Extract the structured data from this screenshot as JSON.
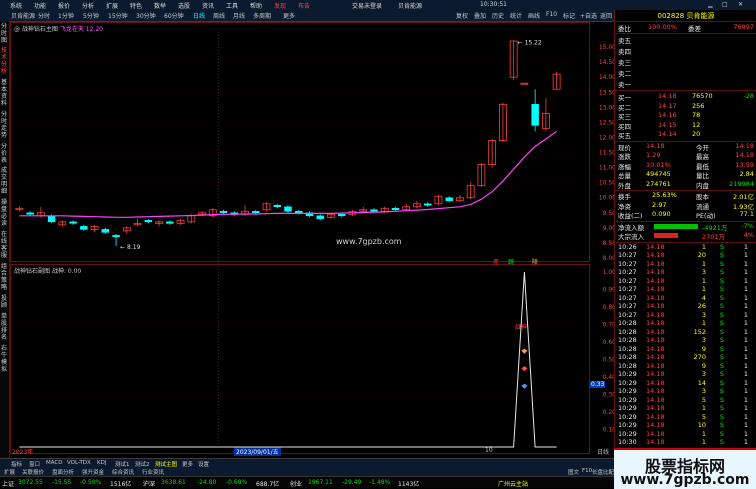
{
  "menubar": {
    "items": [
      "系统",
      "功能",
      "报价",
      "分析",
      "扩展",
      "特色",
      "数举",
      "选股",
      "资讯",
      "工具",
      "帮助"
    ],
    "highlight": [
      "发现",
      "布告"
    ],
    "center": [
      "交易未登录",
      "贝肯能源"
    ],
    "time": "10:30:51"
  },
  "toolbar": {
    "items": [
      "贝肯能源",
      "分时",
      "1分钟",
      "5分钟",
      "15分钟",
      "30分钟",
      "60分钟",
      "日线",
      "周线",
      "月线",
      "多周期",
      "更多"
    ],
    "active": "日线",
    "right": [
      "复权",
      "叠加",
      "历史",
      "统计",
      "画线",
      "F10",
      "标记",
      "+自选",
      "返回"
    ]
  },
  "leftrail": [
    "分时图",
    "技术分析",
    "基本资料",
    "分时走势",
    "分价表",
    "成交明细",
    "操盘必读",
    "在线客服",
    "组合策略",
    "投顾",
    "单股排名",
    "右牛模拟"
  ],
  "mainchart": {
    "title": "战神钻石主图",
    "title_prefix": "@",
    "pink_label": "飞龙在天",
    "pink_value": "12.20",
    "high_label": "15.22",
    "low_label": "8.19",
    "ticks": [
      "15.00",
      "14.50",
      "14.00",
      "13.50",
      "13.00",
      "12.50",
      "12.00",
      "11.50",
      "11.00",
      "10.50",
      "10.00",
      "9.50",
      "9.00",
      "8.50",
      "8.00"
    ]
  },
  "subchart": {
    "title": "战神钻石副图",
    "title2": "战神: 0.00",
    "signals": [
      "赤",
      "跳",
      "陵"
    ],
    "peak_label": "战神",
    "value_badge": "0.33",
    "ticks": [
      "1.00",
      "0.90",
      "0.80",
      "0.70",
      "0.60",
      "0.50",
      "0.40",
      "0.30",
      "0.20",
      "0.10"
    ],
    "date_label": "2023/09/01/五",
    "year_label": "2023年",
    "x_tick": "10",
    "right_tag": "日线"
  },
  "bottomtabs": [
    "指标",
    "窗口",
    "MACD",
    "VOL-TDX",
    "KDJ",
    "测试1",
    "测试2",
    "测试主图",
    "更多",
    "设置"
  ],
  "bottomtabs_selected": "测试主图",
  "bottom2": [
    "扩展",
    "关联报价",
    "盘面分析",
    "强升资金",
    "综合资讯",
    "行业资讯"
  ],
  "bottom2_right": [
    "图文",
    "F10",
    "长盘比配"
  ],
  "indexbar": [
    {
      "name": "上证",
      "value": "3072.55",
      "chg": "-15.55",
      "pct": "-0.50%",
      "amt": "1516亿"
    },
    {
      "name": "沪深",
      "value": "3638.61",
      "chg": "-24.80",
      "pct": "-0.68%",
      "amt": "688.7亿"
    },
    {
      "name": "创业",
      "value": "1967.11",
      "chg": "-29.49",
      "pct": "-1.48%",
      "amt": "1143亿"
    }
  ],
  "indexbar_right": "广州云主站",
  "quote": {
    "code": "002828",
    "name": "贝肯能源",
    "webi_label": "委比",
    "webi": "100.00%",
    "weicha_label": "委差",
    "weicha": "76997",
    "sell": [
      {
        "label": "卖五",
        "price": "",
        "vol": ""
      },
      {
        "label": "卖四",
        "price": "",
        "vol": ""
      },
      {
        "label": "卖三",
        "price": "",
        "vol": ""
      },
      {
        "label": "卖二",
        "price": "",
        "vol": ""
      },
      {
        "label": "卖一",
        "price": "",
        "vol": ""
      }
    ],
    "buy": [
      {
        "label": "买一",
        "price": "14.18",
        "vol": "76570",
        "chg": "-28"
      },
      {
        "label": "买二",
        "price": "14.17",
        "vol": "256",
        "chg": ""
      },
      {
        "label": "买三",
        "price": "14.16",
        "vol": "78",
        "chg": ""
      },
      {
        "label": "买四",
        "price": "14.15",
        "vol": "12",
        "chg": ""
      },
      {
        "label": "买五",
        "price": "14.14",
        "vol": "20",
        "chg": ""
      }
    ],
    "stats": [
      {
        "l1": "现价",
        "v1": "14.18",
        "l2": "今开",
        "v2": "14.18"
      },
      {
        "l1": "涨跌",
        "v1": "1.29",
        "l2": "最高",
        "v2": "14.18"
      },
      {
        "l1": "涨幅",
        "v1": "10.01%",
        "l2": "最低",
        "v2": "13.59"
      },
      {
        "l1": "总量",
        "v1": "494745",
        "l2": "量比",
        "v2": "2.84"
      },
      {
        "l1": "外盘",
        "v1": "274761",
        "l2": "内盘",
        "v2": "219984"
      }
    ],
    "stats2": [
      {
        "l1": "换手",
        "v1": "25.63%",
        "l2": "股本",
        "v2": "2.01亿"
      },
      {
        "l1": "净资",
        "v1": "2.97",
        "l2": "流通",
        "v2": "1.93亿"
      },
      {
        "l1": "收益(二)",
        "v1": "0.090",
        "l2": "PE(动)",
        "v2": "77.1"
      }
    ],
    "flows": [
      {
        "label": "净流入额",
        "value": "-4921万",
        "pct": "-7%"
      },
      {
        "label": "大宗流入",
        "value": "2701万",
        "pct": "4%"
      }
    ],
    "ticks": [
      {
        "t": "10:26",
        "p": "14.18",
        "v": "1",
        "s": "S",
        "n": "1"
      },
      {
        "t": "10:27",
        "p": "14.18",
        "v": "20",
        "s": "S",
        "n": "1"
      },
      {
        "t": "10:27",
        "p": "14.18",
        "v": "1",
        "s": "S",
        "n": "1"
      },
      {
        "t": "10:27",
        "p": "14.18",
        "v": "3",
        "s": "S",
        "n": "1"
      },
      {
        "t": "10:27",
        "p": "14.18",
        "v": "1",
        "s": "S",
        "n": "1"
      },
      {
        "t": "10:27",
        "p": "14.18",
        "v": "1",
        "s": "S",
        "n": "1"
      },
      {
        "t": "10:27",
        "p": "14.18",
        "v": "4",
        "s": "S",
        "n": "1"
      },
      {
        "t": "10:27",
        "p": "14.18",
        "v": "26",
        "s": "S",
        "n": "1"
      },
      {
        "t": "10:27",
        "p": "14.18",
        "v": "3",
        "s": "S",
        "n": "1"
      },
      {
        "t": "10:28",
        "p": "14.18",
        "v": "1",
        "s": "S",
        "n": "1"
      },
      {
        "t": "10:28",
        "p": "14.18",
        "v": "152",
        "s": "S",
        "n": "1"
      },
      {
        "t": "10:28",
        "p": "14.18",
        "v": "3",
        "s": "S",
        "n": "1"
      },
      {
        "t": "10:28",
        "p": "14.18",
        "v": "9",
        "s": "S",
        "n": "1"
      },
      {
        "t": "10:28",
        "p": "14.18",
        "v": "270",
        "s": "S",
        "n": "1"
      },
      {
        "t": "10:28",
        "p": "14.18",
        "v": "9",
        "s": "S",
        "n": "1"
      },
      {
        "t": "10:29",
        "p": "14.18",
        "v": "3",
        "s": "S",
        "n": "1"
      },
      {
        "t": "10:29",
        "p": "14.18",
        "v": "14",
        "s": "S",
        "n": "1"
      },
      {
        "t": "10:29",
        "p": "14.18",
        "v": "3",
        "s": "S",
        "n": "1"
      },
      {
        "t": "10:29",
        "p": "14.18",
        "v": "5",
        "s": "S",
        "n": "1"
      },
      {
        "t": "10:29",
        "p": "14.18",
        "v": "1",
        "s": "S",
        "n": "1"
      },
      {
        "t": "10:29",
        "p": "14.18",
        "v": "5",
        "s": "S",
        "n": "1"
      },
      {
        "t": "10:29",
        "p": "14.18",
        "v": "10",
        "s": "S",
        "n": "1"
      },
      {
        "t": "10:29",
        "p": "14.18",
        "v": "1",
        "s": "S",
        "n": "1"
      },
      {
        "t": "10:30",
        "p": "14.18",
        "v": "1",
        "s": "S",
        "n": "1"
      }
    ]
  },
  "watermark": {
    "line1": "股票指标网",
    "line2": "www.7gpzb.com"
  },
  "site_mark": "www.7gpzb.com",
  "candles": [
    {
      "o": 9.6,
      "c": 9.65,
      "h": 9.7,
      "l": 9.55,
      "up": true
    },
    {
      "o": 9.5,
      "c": 9.45,
      "h": 9.55,
      "l": 9.4,
      "up": false
    },
    {
      "o": 9.4,
      "c": 9.5,
      "h": 9.7,
      "l": 9.35,
      "up": true
    },
    {
      "o": 9.4,
      "c": 9.2,
      "h": 9.45,
      "l": 9.15,
      "up": false
    },
    {
      "o": 9.1,
      "c": 9.2,
      "h": 9.25,
      "l": 9.05,
      "up": true
    },
    {
      "o": 9.2,
      "c": 9.15,
      "h": 9.25,
      "l": 9.1,
      "up": false
    },
    {
      "o": 9.05,
      "c": 8.95,
      "h": 9.1,
      "l": 8.9,
      "up": false
    },
    {
      "o": 8.95,
      "c": 9.05,
      "h": 9.1,
      "l": 8.85,
      "up": true
    },
    {
      "o": 8.95,
      "c": 8.85,
      "h": 9.0,
      "l": 8.8,
      "up": false
    },
    {
      "o": 8.75,
      "c": 8.7,
      "h": 8.8,
      "l": 8.4,
      "up": false
    },
    {
      "o": 8.9,
      "c": 9.0,
      "h": 9.05,
      "l": 8.8,
      "up": true
    },
    {
      "o": 9.1,
      "c": 9.15,
      "h": 9.3,
      "l": 9.05,
      "up": true
    },
    {
      "o": 9.25,
      "c": 9.2,
      "h": 9.3,
      "l": 9.15,
      "up": false
    },
    {
      "o": 9.15,
      "c": 9.2,
      "h": 9.25,
      "l": 9.05,
      "up": true
    },
    {
      "o": 9.2,
      "c": 9.15,
      "h": 9.25,
      "l": 9.1,
      "up": false
    },
    {
      "o": 9.15,
      "c": 9.25,
      "h": 9.3,
      "l": 9.1,
      "up": true
    },
    {
      "o": 9.2,
      "c": 9.4,
      "h": 9.45,
      "l": 9.15,
      "up": false
    },
    {
      "o": 9.45,
      "c": 9.5,
      "h": 9.55,
      "l": 9.4,
      "up": true
    },
    {
      "o": 9.4,
      "c": 9.6,
      "h": 9.65,
      "l": 9.35,
      "up": false
    },
    {
      "o": 9.55,
      "c": 9.5,
      "h": 9.6,
      "l": 9.45,
      "up": false
    },
    {
      "o": 9.5,
      "c": 9.45,
      "h": 9.55,
      "l": 9.4,
      "up": false
    },
    {
      "o": 9.45,
      "c": 9.55,
      "h": 9.75,
      "l": 9.4,
      "up": true
    },
    {
      "o": 9.55,
      "c": 9.5,
      "h": 9.6,
      "l": 9.45,
      "up": false
    },
    {
      "o": 9.6,
      "c": 9.8,
      "h": 9.85,
      "l": 9.55,
      "up": false
    },
    {
      "o": 9.75,
      "c": 9.7,
      "h": 9.8,
      "l": 9.65,
      "up": false
    },
    {
      "o": 9.7,
      "c": 9.55,
      "h": 9.75,
      "l": 9.5,
      "up": false
    },
    {
      "o": 9.55,
      "c": 9.5,
      "h": 9.6,
      "l": 9.45,
      "up": false
    },
    {
      "o": 9.5,
      "c": 9.4,
      "h": 9.55,
      "l": 9.35,
      "up": false
    },
    {
      "o": 9.4,
      "c": 9.3,
      "h": 9.45,
      "l": 9.25,
      "up": false
    },
    {
      "o": 9.35,
      "c": 9.45,
      "h": 9.5,
      "l": 9.3,
      "up": true
    },
    {
      "o": 9.45,
      "c": 9.4,
      "h": 9.5,
      "l": 9.35,
      "up": false
    },
    {
      "o": 9.45,
      "c": 9.55,
      "h": 9.6,
      "l": 9.4,
      "up": true
    },
    {
      "o": 9.55,
      "c": 9.6,
      "h": 9.7,
      "l": 9.5,
      "up": true
    },
    {
      "o": 9.6,
      "c": 9.55,
      "h": 9.65,
      "l": 9.5,
      "up": false
    },
    {
      "o": 9.55,
      "c": 9.65,
      "h": 9.7,
      "l": 9.5,
      "up": true
    },
    {
      "o": 9.65,
      "c": 9.6,
      "h": 9.7,
      "l": 9.55,
      "up": false
    },
    {
      "o": 9.6,
      "c": 9.7,
      "h": 9.8,
      "l": 9.55,
      "up": true
    },
    {
      "o": 9.7,
      "c": 9.8,
      "h": 9.9,
      "l": 9.65,
      "up": true
    },
    {
      "o": 9.8,
      "c": 9.75,
      "h": 9.85,
      "l": 9.7,
      "up": false
    },
    {
      "o": 9.8,
      "c": 10.05,
      "h": 10.1,
      "l": 9.75,
      "up": false
    },
    {
      "o": 10.0,
      "c": 9.9,
      "h": 10.05,
      "l": 9.85,
      "up": true
    },
    {
      "o": 9.9,
      "c": 10.0,
      "h": 10.1,
      "l": 9.85,
      "up": true
    },
    {
      "o": 10.0,
      "c": 10.4,
      "h": 10.5,
      "l": 9.95,
      "up": true
    },
    {
      "o": 10.4,
      "c": 11.1,
      "h": 11.15,
      "l": 10.35,
      "up": true
    },
    {
      "o": 11.1,
      "c": 11.9,
      "h": 11.95,
      "l": 11.0,
      "up": true
    },
    {
      "o": 11.9,
      "c": 13.1,
      "h": 13.15,
      "l": 11.85,
      "up": true
    },
    {
      "o": 14.0,
      "c": 15.2,
      "h": 15.22,
      "l": 13.9,
      "up": true
    },
    {
      "o": 13.8,
      "c": 13.8,
      "h": 13.8,
      "l": 13.8,
      "up": true
    },
    {
      "o": 13.1,
      "c": 12.4,
      "h": 13.6,
      "l": 12.2,
      "up": true
    },
    {
      "o": 12.3,
      "c": 12.8,
      "h": 13.3,
      "l": 12.2,
      "up": true
    },
    {
      "o": 13.6,
      "c": 14.1,
      "h": 14.18,
      "l": 13.6,
      "up": true
    }
  ],
  "ma": [
    9.4,
    9.4,
    9.4,
    9.4,
    9.4,
    9.39,
    9.38,
    9.37,
    9.36,
    9.35,
    9.35,
    9.36,
    9.37,
    9.38,
    9.39,
    9.4,
    9.41,
    9.42,
    9.44,
    9.45,
    9.45,
    9.46,
    9.46,
    9.47,
    9.48,
    9.48,
    9.48,
    9.48,
    9.48,
    9.48,
    9.49,
    9.5,
    9.51,
    9.52,
    9.53,
    9.55,
    9.57,
    9.59,
    9.61,
    9.64,
    9.67,
    9.7,
    9.78,
    9.95,
    10.2,
    10.55,
    10.95,
    11.35,
    11.7,
    11.95,
    12.2
  ],
  "sub_series": [
    0,
    0,
    0,
    0,
    0,
    0,
    0,
    0,
    0,
    0,
    0,
    0,
    0,
    0,
    0,
    0,
    0,
    0,
    0,
    0,
    0,
    0,
    0,
    0,
    0,
    0,
    0,
    0,
    0,
    0,
    0,
    0,
    0,
    0,
    0,
    0,
    0,
    0,
    0,
    0,
    0,
    0,
    0,
    0,
    0,
    0,
    0,
    1.0,
    0,
    0,
    0
  ]
}
